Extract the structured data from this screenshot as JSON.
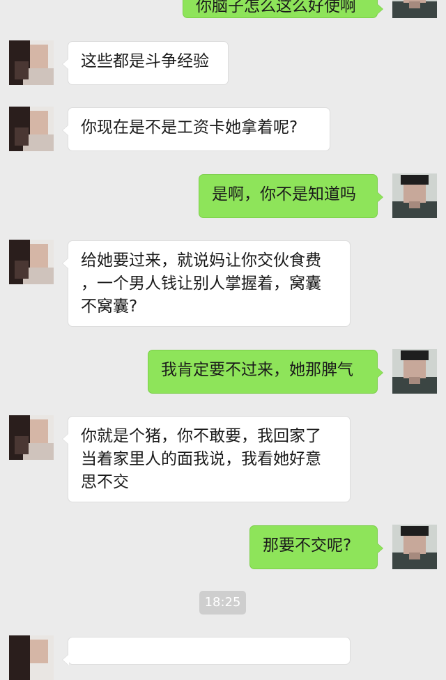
{
  "theme": {
    "background": "#ebebeb",
    "incoming_bubble": "#ffffff",
    "outgoing_bubble": "#8ee45a"
  },
  "messages": [
    {
      "side": "right",
      "text": "你脑子怎么这么好使啊"
    },
    {
      "side": "left",
      "text": "这些都是斗争经验"
    },
    {
      "side": "left",
      "text": "你现在是不是工资卡她拿着呢?"
    },
    {
      "side": "right",
      "text": "是啊，你不是知道吗"
    },
    {
      "side": "left",
      "text": "给她要过来，就说妈让你交伙食费\n，一个男人钱让别人掌握着，窝囊\n不窝囊?"
    },
    {
      "side": "right",
      "text": "我肯定要不过来，她那脾气"
    },
    {
      "side": "left",
      "text": "你就是个猪，你不敢要，我回家了\n当着家里人的面我说，我看她好意\n思不交"
    },
    {
      "side": "right",
      "text": "那要不交呢?"
    }
  ],
  "timestamp": "18:25",
  "icons": {
    "contact_avatar": "female-avatar-icon",
    "self_avatar": "male-avatar-icon"
  }
}
